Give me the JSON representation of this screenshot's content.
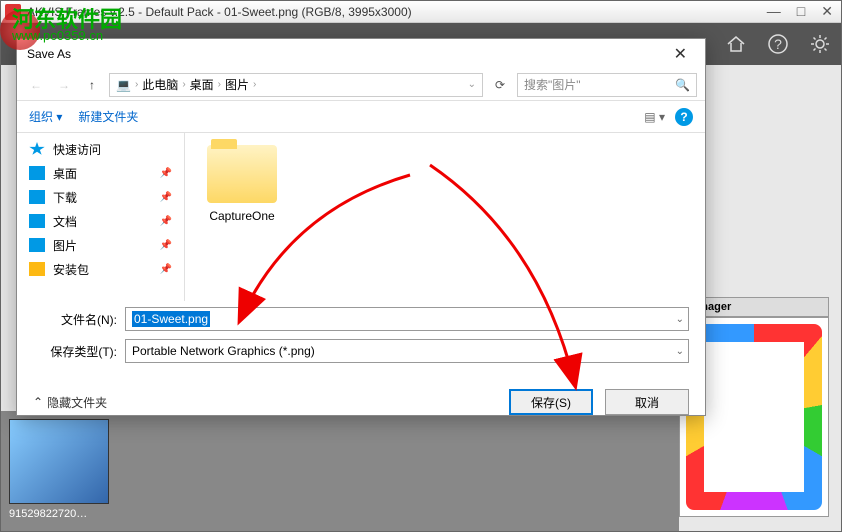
{
  "main": {
    "title": "AKVIS Frames v.2.5 - Default Pack - 01-Sweet.png (RGB/8, 3995x3000)",
    "min": "—",
    "square": "□",
    "close": "✕"
  },
  "watermark": {
    "main": "河东软件园",
    "sub": "www.pc0359.cn"
  },
  "dialog": {
    "title": "Save As",
    "close": "✕",
    "breadcrumb": {
      "root_icon": "💻",
      "p1": "此电脑",
      "p2": "桌面",
      "p3": "图片"
    },
    "search_placeholder": "搜索\"图片\"",
    "toolbar": {
      "organize": "组织 ▾",
      "newfolder": "新建文件夹"
    },
    "sidebar": [
      {
        "label": "快速访问",
        "icon": "ico-star",
        "pin": false
      },
      {
        "label": "桌面",
        "icon": "ico-desktop",
        "pin": true
      },
      {
        "label": "下载",
        "icon": "ico-download",
        "pin": true
      },
      {
        "label": "文档",
        "icon": "ico-doc",
        "pin": true
      },
      {
        "label": "图片",
        "icon": "ico-pic",
        "pin": true
      },
      {
        "label": "安装包",
        "icon": "ico-folder",
        "pin": true
      }
    ],
    "content": {
      "folder1": "CaptureOne"
    },
    "fields": {
      "filename_label": "文件名(N):",
      "filename_value": "01-Sweet.png",
      "type_label": "保存类型(T):",
      "type_value": "Portable Network Graphics (*.png)"
    },
    "footer": {
      "hide": "隐藏文件夹",
      "save": "保存(S)",
      "cancel": "取消"
    }
  },
  "thumb": {
    "label": "91529822720…"
  },
  "rpanel": {
    "manager": "Manager"
  }
}
